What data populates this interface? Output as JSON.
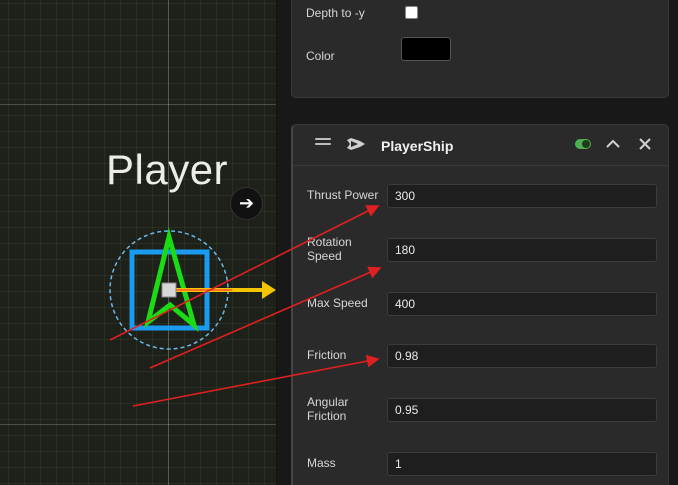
{
  "scene": {
    "object_label": "Player",
    "goto_icon": "arrow-right-icon"
  },
  "top_panel": {
    "depth_label": "Depth to -y",
    "depth_checked": false,
    "color_label": "Color",
    "color_value": "#000000"
  },
  "component": {
    "title": "PlayerShip",
    "icon": "spaceship-icon",
    "enabled": true,
    "properties": [
      {
        "label": "Thrust Power",
        "value": "300"
      },
      {
        "label": "Rotation Speed",
        "value": "180"
      },
      {
        "label": "Max Speed",
        "value": "400"
      },
      {
        "label": "Friction",
        "value": "0.98"
      },
      {
        "label": "Angular Friction",
        "value": "0.95"
      },
      {
        "label": "Mass",
        "value": "1"
      }
    ]
  },
  "colors": {
    "ship_outline": "#1adb14",
    "bounding_box": "#1a9bf0",
    "collider_circle": "#6db8e8",
    "direction_arrow": "#f5c400",
    "annotation_arrow": "#e02020",
    "toggle_on": "#4caf50"
  }
}
